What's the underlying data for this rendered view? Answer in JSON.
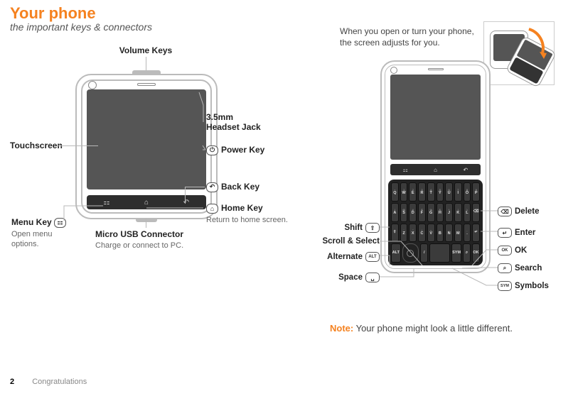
{
  "page": {
    "title": "Your phone",
    "subtitle": "the important keys & connectors",
    "footer_page": "2",
    "footer_section": "Congratulations"
  },
  "open_note": "When you open or turn your phone, the screen adjusts for you.",
  "bottom_note": {
    "label": "Note:",
    "text": " Your phone might look a little different."
  },
  "left_labels": {
    "volume": "Volume Keys",
    "touchscreen": "Touchscreen",
    "headset35": "3.5mm",
    "headset35b": "Headset Jack",
    "power": "Power Key",
    "back": "Back Key",
    "home": "Home Key",
    "home_sub": "Return to home screen.",
    "menu": "Menu Key",
    "menu_sub": "Open menu options.",
    "usb": "Micro USB  Connector",
    "usb_sub": "Charge or connect to PC."
  },
  "left_icons": {
    "power": "⏻",
    "back": "↶",
    "home": "⌂",
    "menu": "⚏"
  },
  "nav": {
    "menu": "⚏",
    "home": "⌂",
    "back": "↶"
  },
  "keyboard": {
    "r1": [
      {
        "s": "~",
        "m": "Q"
      },
      {
        "s": "1",
        "m": "W"
      },
      {
        "s": "2",
        "m": "E"
      },
      {
        "s": "3",
        "m": "R"
      },
      {
        "s": "4",
        "m": "T"
      },
      {
        "s": "5",
        "m": "Y"
      },
      {
        "s": "6",
        "m": "U"
      },
      {
        "s": "7",
        "m": "I"
      },
      {
        "s": "8",
        "m": "O"
      },
      {
        "s": "9",
        "m": "P"
      }
    ],
    "r2": [
      {
        "s": "!",
        "m": "A"
      },
      {
        "s": "@",
        "m": "S"
      },
      {
        "s": "#",
        "m": "D"
      },
      {
        "s": "$",
        "m": "F"
      },
      {
        "s": "%",
        "m": "G"
      },
      {
        "s": "&",
        "m": "H"
      },
      {
        "s": "*",
        "m": "J"
      },
      {
        "s": "(",
        "m": "K"
      },
      {
        "s": ")",
        "m": "L"
      },
      {
        "s": "",
        "m": "⌫"
      }
    ],
    "r3": [
      {
        "s": "",
        "m": "⇧"
      },
      {
        "s": "'",
        "m": "Z"
      },
      {
        "s": "\"",
        "m": "X"
      },
      {
        "s": "+",
        "m": "C"
      },
      {
        "s": "=",
        "m": "V"
      },
      {
        "s": "-",
        "m": "B"
      },
      {
        "s": ";",
        "m": "N"
      },
      {
        "s": ":",
        "m": "M"
      },
      {
        "s": ",",
        "m": "."
      },
      {
        "s": "",
        "m": "↵"
      }
    ],
    "r4": {
      "alt": "ALT",
      "slash": "/",
      "space": " ",
      "sym": "SYM",
      "search": "⌕",
      "ok": "OK"
    }
  },
  "right_labels": {
    "shift": "Shift",
    "scroll": "Scroll & Select",
    "alt": "Alternate",
    "space": "Space",
    "delete": "Delete",
    "enter": "Enter",
    "ok": "OK",
    "search": "Search",
    "symbols": "Symbols"
  },
  "right_icons": {
    "shift": "⇧",
    "alt": "ALT",
    "space": "␣",
    "delete": "⌫",
    "enter": "↵",
    "ok": "OK",
    "search": "⌕",
    "sym": "SYM"
  }
}
